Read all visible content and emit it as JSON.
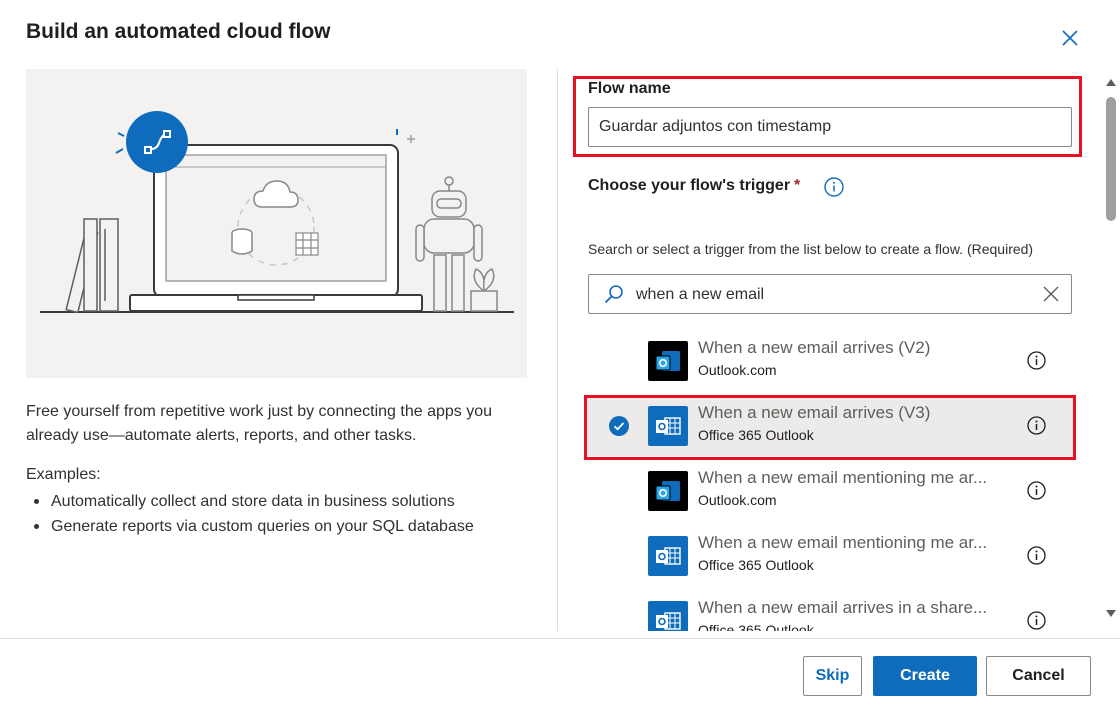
{
  "dialog": {
    "title": "Build an automated cloud flow",
    "close_icon": "close-icon"
  },
  "left": {
    "description": "Free yourself from repetitive work just by connecting the apps you already use—automate alerts, reports, and other tasks.",
    "examples_heading": "Examples:",
    "examples": [
      "Automatically collect and store data in business solutions",
      "Generate reports via custom queries on your SQL database"
    ]
  },
  "form": {
    "flow_name_label": "Flow name",
    "flow_name_value": "Guardar adjuntos con timestamp",
    "trigger_label": "Choose your flow's trigger",
    "required_marker": "*",
    "helper_text": "Search or select a trigger from the list below to create a flow. (Required)",
    "search_value": "when a new email"
  },
  "triggers": [
    {
      "name": "When a new email arrives (V2)",
      "connector": "Outlook.com",
      "icon": "outlook-com-icon",
      "selected": false
    },
    {
      "name": "When a new email arrives (V3)",
      "connector": "Office 365 Outlook",
      "icon": "office365-outlook-icon",
      "selected": true
    },
    {
      "name": "When a new email mentioning me ar...",
      "connector": "Outlook.com",
      "icon": "outlook-com-icon",
      "selected": false
    },
    {
      "name": "When a new email mentioning me ar...",
      "connector": "Office 365 Outlook",
      "icon": "office365-outlook-icon",
      "selected": false
    },
    {
      "name": "When a new email arrives in a share...",
      "connector": "Office 365 Outlook",
      "icon": "office365-outlook-icon",
      "selected": false
    }
  ],
  "footer": {
    "skip_label": "Skip",
    "create_label": "Create",
    "cancel_label": "Cancel"
  },
  "colors": {
    "accent": "#0f6cbd",
    "highlight": "#e81123",
    "outlook_com_bg": "#000000",
    "office365_bg": "#0f6cbd"
  }
}
